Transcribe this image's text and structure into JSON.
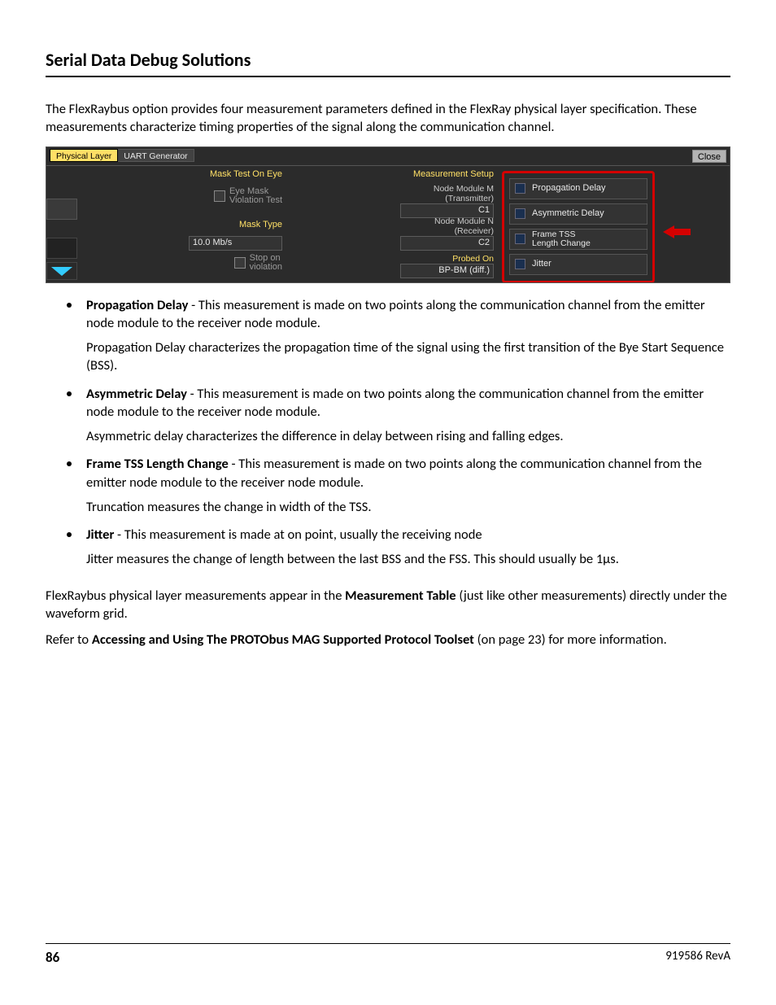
{
  "header": {
    "title": "Serial Data Debug Solutions"
  },
  "intro": "The FlexRaybus option provides four measurement parameters defined in the FlexRay physical layer specification. These measurements characterize timing properties of the signal along the communication channel.",
  "screenshot": {
    "tabs": {
      "active": "Physical Layer",
      "inactive": "UART Generator"
    },
    "close": "Close",
    "left": {
      "mask_test_label": "Mask Test On Eye",
      "eye_mask_l1": "Eye Mask",
      "eye_mask_l2": "Violation Test",
      "mask_type_label": "Mask Type",
      "mask_type_value": "10.0 Mb/s",
      "stop_l1": "Stop on",
      "stop_l2": "violation"
    },
    "mid": {
      "setup_label": "Measurement Setup",
      "mod_m_l1": "Node Module M",
      "mod_m_l2": "(Transmitter)",
      "mod_m_value": "C1",
      "mod_n_l1": "Node Module N",
      "mod_n_l2": "(Receiver)",
      "mod_n_value": "C2",
      "probed_label": "Probed On",
      "probed_value": "BP-BM (diff.)"
    },
    "measurements": {
      "b1": "Propagation Delay",
      "b2": "Asymmetric Delay",
      "b3_l1": "Frame TSS",
      "b3_l2": "Length Change",
      "b4": "Jitter"
    }
  },
  "bullets": [
    {
      "term": "Propagation Delay",
      "lead": " - This measurement is made on two points along the communication channel from the emitter node module to the receiver node module.",
      "extra": "Propagation Delay characterizes the propagation time of the signal using the first transition of the Bye Start Sequence (BSS)."
    },
    {
      "term": "Asymmetric Delay",
      "lead": " - This measurement is made on two points along the communication channel from the emitter node module to the receiver node module.",
      "extra": "Asymmetric delay characterizes the difference in delay between rising and falling edges."
    },
    {
      "term": "Frame TSS Length Change",
      "lead": " - This measurement is made on two points along the communication channel from the emitter node module to the receiver node module.",
      "extra": "Truncation measures the change in width of the TSS."
    },
    {
      "term": "Jitter",
      "lead": " - This measurement is made at on point, usually the receiving node",
      "extra": "Jitter measures the change of length between the last BSS and the FSS. This should usually be 1µs."
    }
  ],
  "after": {
    "p1a": "FlexRaybus physical layer measurements appear in the ",
    "p1b": "Measurement Table",
    "p1c": " (just like other measurements) directly under the waveform grid.",
    "p2a": "Refer to ",
    "p2b": "Accessing and Using The PROTObus MAG Supported Protocol Toolset",
    "p2c": " (on page 23) for more information."
  },
  "footer": {
    "page": "86",
    "rev": "919586 RevA"
  }
}
